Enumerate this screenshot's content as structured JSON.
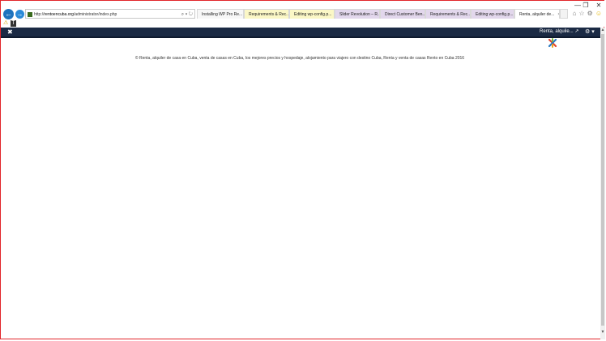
{
  "window": {
    "buttons": [
      {
        "name": "minimize-button",
        "glyph": "—"
      },
      {
        "name": "restore-button",
        "glyph": "❐"
      },
      {
        "name": "close-window-button",
        "glyph": "✕"
      }
    ]
  },
  "nav": {
    "back_glyph": "←",
    "forward_glyph": "→"
  },
  "address": {
    "prefix": "http://",
    "domain": "rentoencuba.org",
    "path": "/administrator/index.php",
    "tools": "⌕ ▾ ↻"
  },
  "tabs": [
    {
      "label": "Installing WP Pro Re...",
      "icon_color": "#2e7bd6",
      "bg": "#f7f7f7"
    },
    {
      "label": "Requirements & Rec...",
      "icon_color": "#e6a400",
      "bg": "#fbf7c6"
    },
    {
      "label": "Editing wp-config.p...",
      "icon_color": "#666666",
      "bg": "#fbf7c6"
    },
    {
      "label": "Slider Revolution – R...",
      "icon_color": "#6d6db3",
      "bg": "#e2d7ec"
    },
    {
      "label": "Direct Customer Ben...",
      "icon_color": "#d42020",
      "bg": "#e2d7ec"
    },
    {
      "label": "Requirements & Rec...",
      "icon_color": "#e6a400",
      "bg": "#e2d7ec"
    },
    {
      "label": "Editing wp-config.p...",
      "icon_color": "#666666",
      "bg": "#e2d7ec"
    },
    {
      "label": "Renta, alquiler de...",
      "icon_color": "#2b9b3a",
      "bg": "#ffffff",
      "active": true,
      "close": "×"
    }
  ],
  "right_icons": {
    "home": "⌂",
    "star": "☆",
    "settings": "⚙",
    "smiley": "☺"
  },
  "favorites": [
    "⚠",
    "T"
  ],
  "admin_bar": {
    "logo_glyph": "✖",
    "site_label": "Renta, alquile... ↗",
    "settings_glyph": "⚙ ▾"
  },
  "footer": {
    "text": "© Renta, alquiler de casa en Cuba, venta de casas en Cuba, los mejores precios y hospedaje, alojamiento para viajero con destino Cuba, Renta y venta de casas Rento en Cuba 2016"
  },
  "scrollbar": {
    "up": "▲",
    "down": "▼"
  },
  "colors": {
    "admin_bar": "#1b2a44",
    "border": "#e2252a"
  }
}
